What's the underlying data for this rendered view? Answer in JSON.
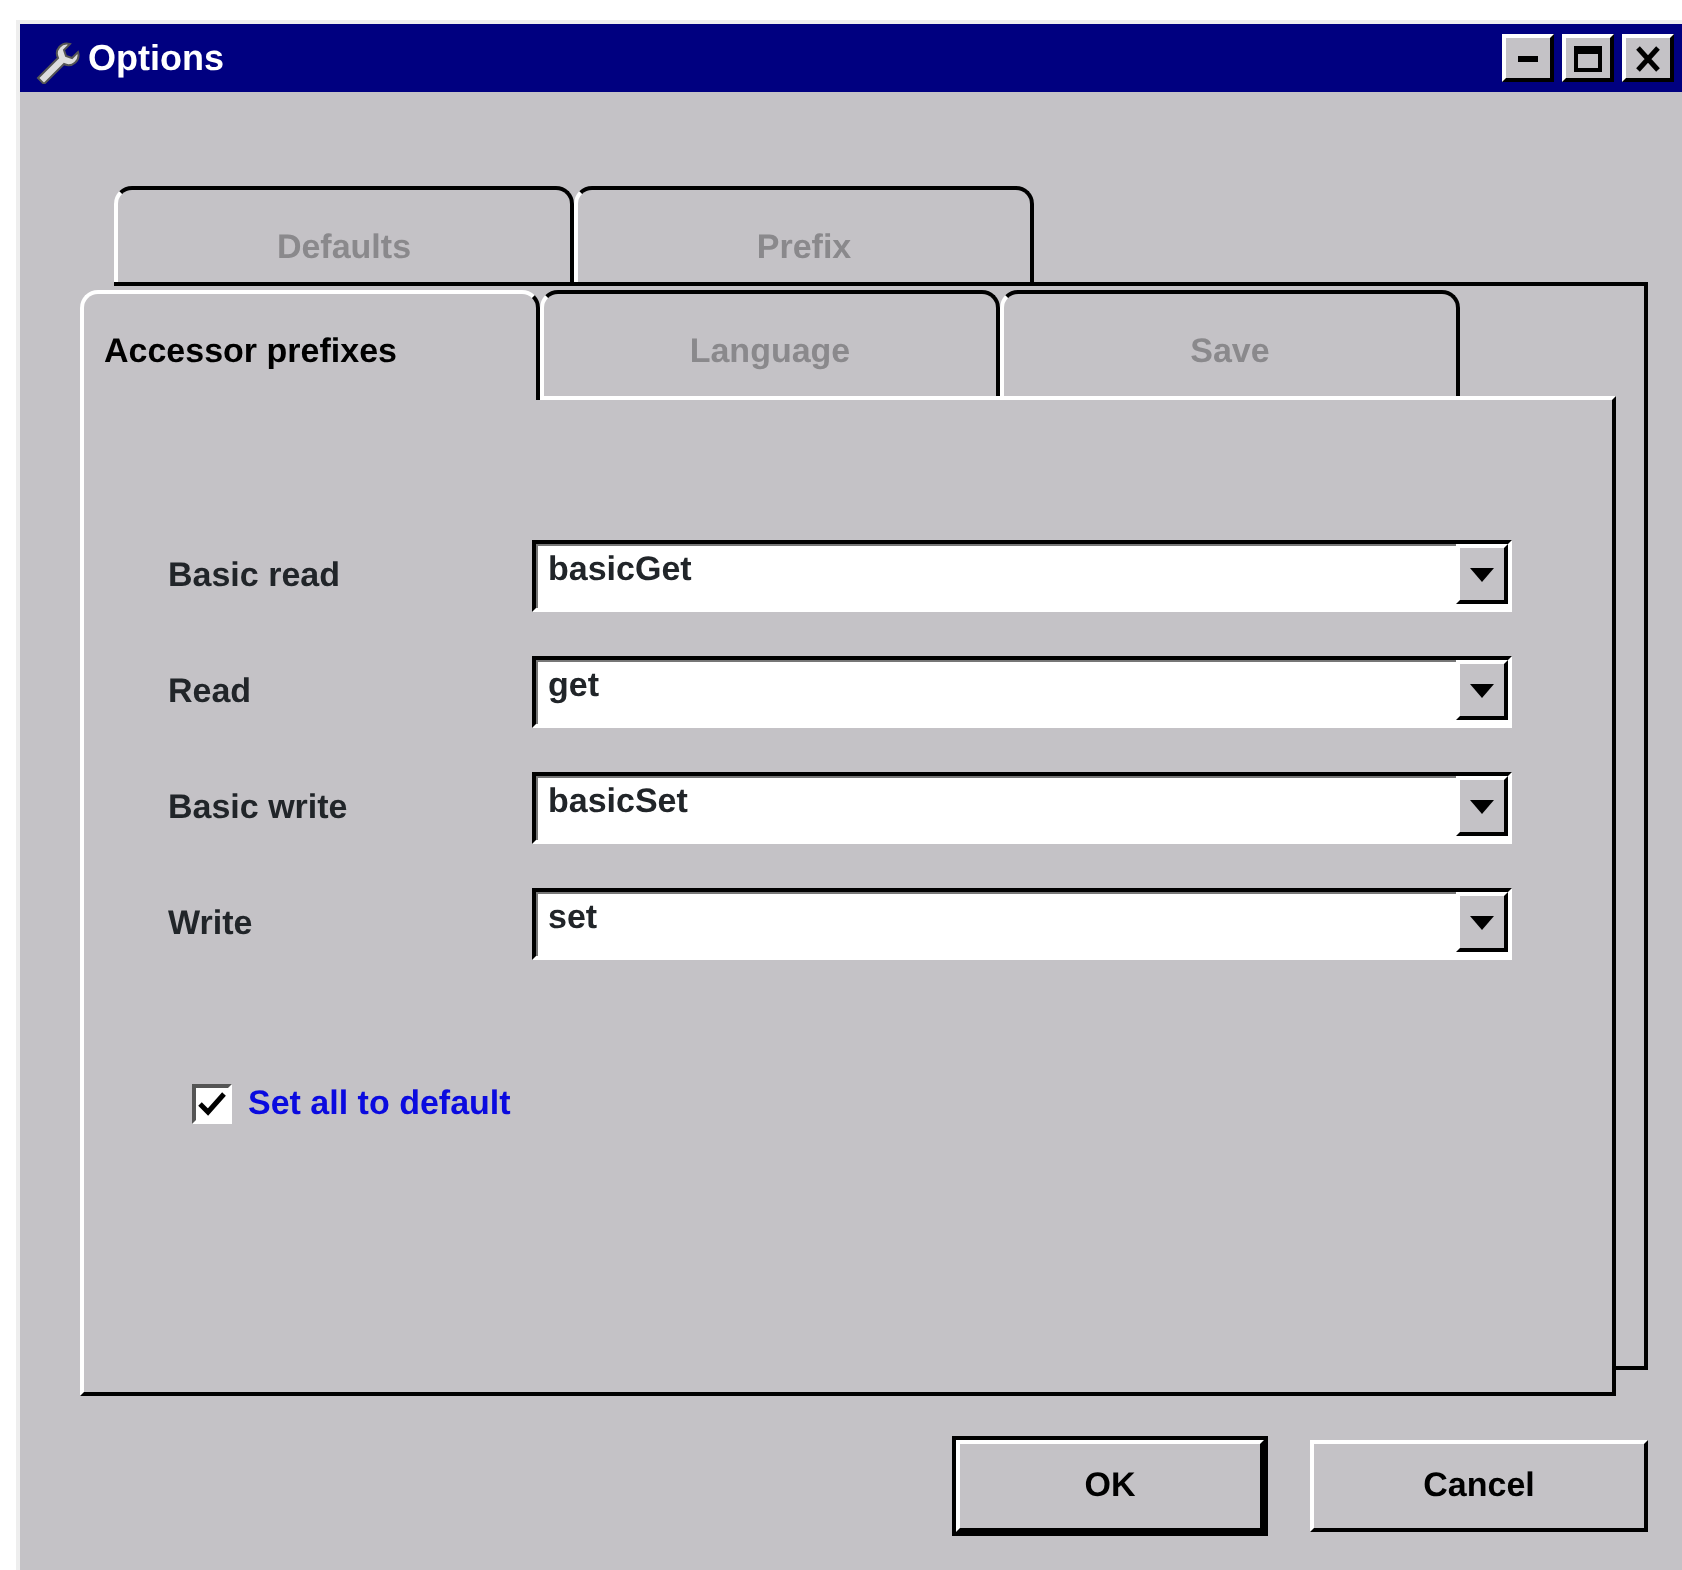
{
  "window": {
    "title": "Options"
  },
  "tab_rows": [
    {
      "tabs": [
        {
          "label": "Defaults",
          "selected": false
        },
        {
          "label": "Prefix",
          "selected": false
        }
      ]
    },
    {
      "tabs": [
        {
          "label": "Accessor prefixes",
          "selected": true
        },
        {
          "label": "Language",
          "selected": false
        },
        {
          "label": "Save",
          "selected": false
        }
      ]
    }
  ],
  "fields": [
    {
      "label": "Basic read",
      "value": "basicGet"
    },
    {
      "label": "Read",
      "value": "get"
    },
    {
      "label": "Basic write",
      "value": "basicSet"
    },
    {
      "label": "Write",
      "value": "set"
    }
  ],
  "checkbox": {
    "label": "Set all to default",
    "checked": true
  },
  "buttons": [
    {
      "label": "OK",
      "default": true
    },
    {
      "label": "Cancel",
      "default": false
    }
  ]
}
